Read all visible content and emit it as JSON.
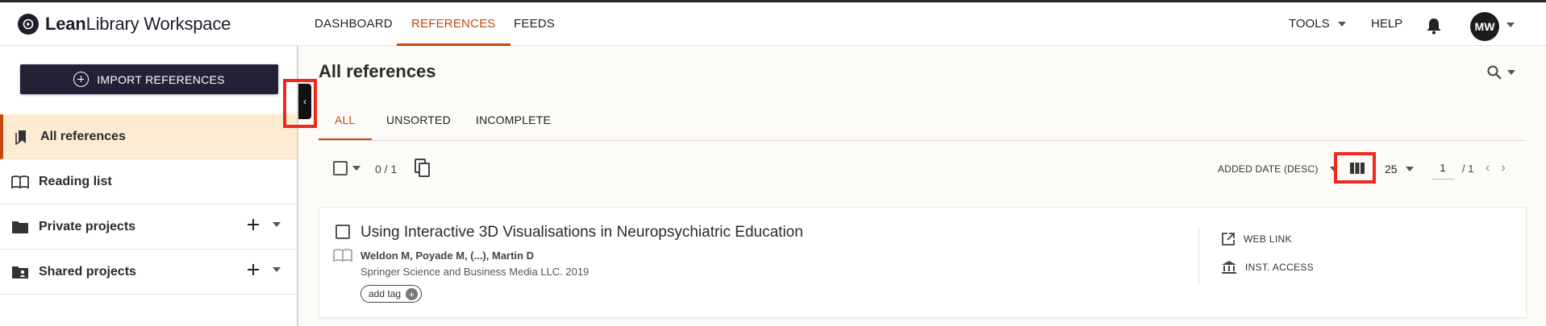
{
  "header": {
    "logo_bold": "Lean",
    "logo_rest": "Library Workspace",
    "nav": [
      {
        "label": "DASHBOARD",
        "active": false
      },
      {
        "label": "REFERENCES",
        "active": true
      },
      {
        "label": "FEEDS",
        "active": false
      }
    ],
    "tools_label": "TOOLS",
    "help_label": "HELP",
    "avatar_initials": "MW"
  },
  "sidebar": {
    "import_label": "IMPORT REFERENCES",
    "items": [
      {
        "label": "All references",
        "icon": "bookmarks-icon",
        "active": true
      },
      {
        "label": "Reading list",
        "icon": "open-book-icon",
        "active": false
      },
      {
        "label": "Private projects",
        "icon": "folder-icon",
        "active": false
      },
      {
        "label": "Shared projects",
        "icon": "shared-folder-icon",
        "active": false
      }
    ]
  },
  "main": {
    "title": "All references",
    "tabs": [
      {
        "label": "ALL",
        "active": true
      },
      {
        "label": "UNSORTED",
        "active": false
      },
      {
        "label": "INCOMPLETE",
        "active": false
      }
    ],
    "toolbar": {
      "selection_count": "0 / 1",
      "sort_label": "ADDED DATE (DESC)",
      "per_page": "25",
      "page_current": "1",
      "page_total": "/ 1"
    },
    "references": [
      {
        "title": "Using Interactive 3D Visualisations in Neuropsychiatric Education",
        "authors": "Weldon M, Poyade M, (...), Martin D",
        "publisher": "Springer Science and Business Media LLC. 2019",
        "tag_label": "add tag",
        "web_link_label": "WEB LINK",
        "inst_access_label": "INST. ACCESS"
      }
    ]
  },
  "colors": {
    "accent": "#c4480f",
    "dark_button": "#232136",
    "active_bg": "#fdecd2",
    "highlight": "#ee2a1f"
  }
}
